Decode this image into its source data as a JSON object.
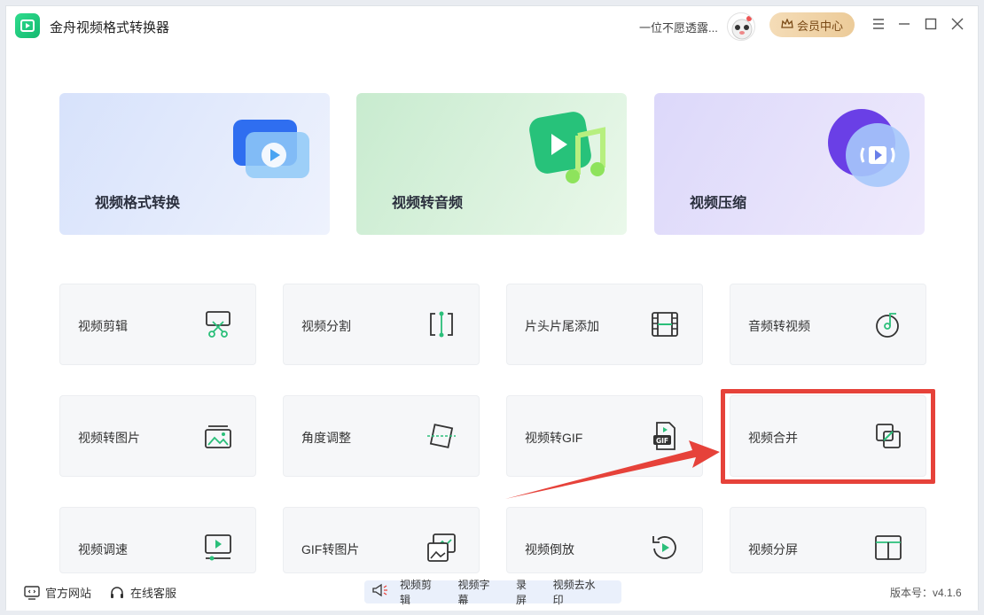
{
  "app": {
    "title": "金舟视频格式转换器"
  },
  "user": {
    "name": "一位不愿透露..."
  },
  "vip": {
    "label": "会员中心"
  },
  "features": [
    {
      "label": "视频格式转换",
      "icon": "video-play-icon"
    },
    {
      "label": "视频转音频",
      "icon": "music-note-icon"
    },
    {
      "label": "视频压缩",
      "icon": "compress-icon"
    }
  ],
  "tools": [
    {
      "label": "视频剪辑",
      "icon": "scissors-icon"
    },
    {
      "label": "视频分割",
      "icon": "split-icon"
    },
    {
      "label": "片头片尾添加",
      "icon": "film-strip-icon"
    },
    {
      "label": "音频转视频",
      "icon": "music-disc-icon"
    },
    {
      "label": "视频转图片",
      "icon": "image-icon"
    },
    {
      "label": "角度调整",
      "icon": "rotate-frame-icon"
    },
    {
      "label": "视频转GIF",
      "icon": "gif-file-icon"
    },
    {
      "label": "视频合并",
      "icon": "merge-icon"
    },
    {
      "label": "视频调速",
      "icon": "speed-monitor-icon"
    },
    {
      "label": "GIF转图片",
      "icon": "gif-to-image-icon"
    },
    {
      "label": "视频倒放",
      "icon": "reverse-play-icon"
    },
    {
      "label": "视频分屏",
      "icon": "split-screen-icon"
    }
  ],
  "bottom": {
    "website": "官方网站",
    "service": "在线客服",
    "quick": [
      "视频剪辑",
      "视频字幕",
      "录屏",
      "视频去水印"
    ],
    "version": "版本号：v4.1.6"
  },
  "colors": {
    "accent": "#2bbf7a",
    "highlight": "#e6423a",
    "vip": "#eccb99"
  }
}
